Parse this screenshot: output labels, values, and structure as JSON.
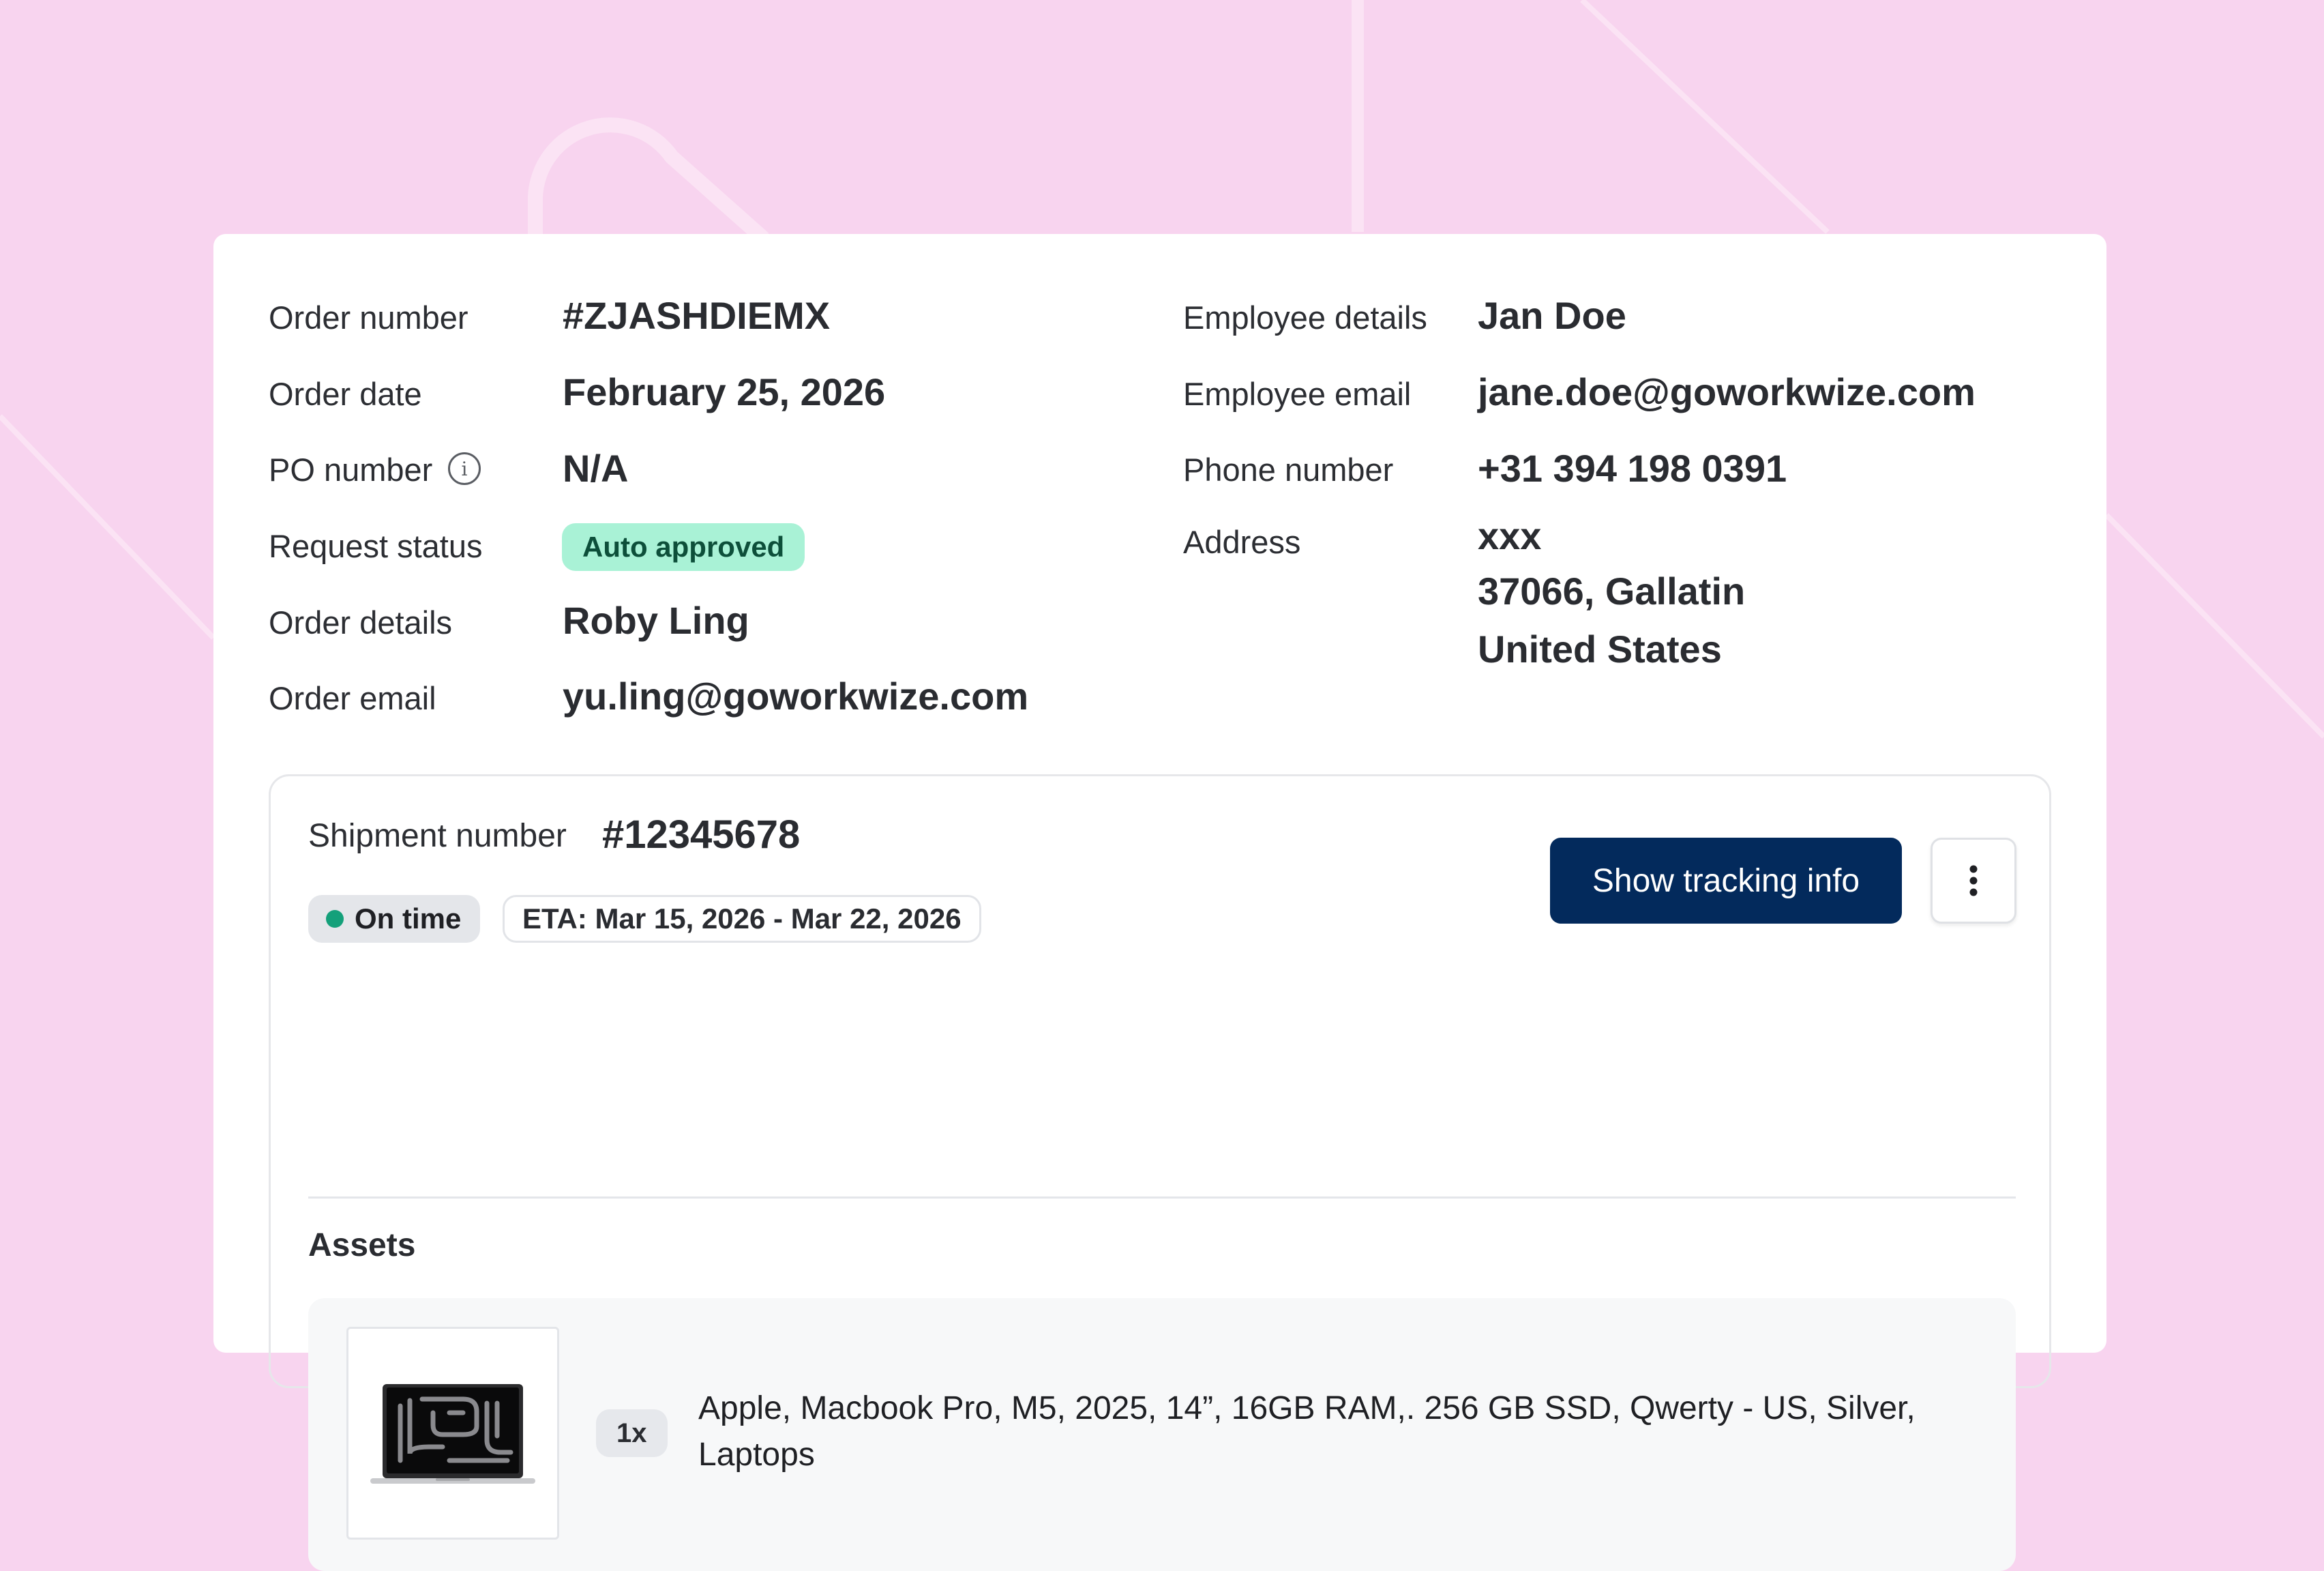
{
  "order": {
    "order_number_label": "Order number",
    "order_number": "#ZJASHDIEMX",
    "order_date_label": "Order date",
    "order_date": "February 25, 2026",
    "po_number_label": "PO number",
    "po_number": "N/A",
    "request_status_label": "Request status",
    "request_status": "Auto approved",
    "order_details_label": "Order details",
    "order_details": "Roby Ling",
    "order_email_label": "Order email",
    "order_email": "yu.ling@goworkwize.com"
  },
  "employee": {
    "details_label": "Employee details",
    "name": "Jan Doe",
    "email_label": "Employee email",
    "email": "jane.doe@goworkwize.com",
    "phone_label": "Phone number",
    "phone": "+31 394 198 0391",
    "address_label": "Address",
    "address_line1": "xxx",
    "address_line2": "37066, Gallatin",
    "address_line3": "United States"
  },
  "shipment": {
    "number_label": "Shipment number",
    "number": "#12345678",
    "status": "On time",
    "eta": "ETA: Mar 15, 2026 - Mar 22, 2026",
    "tracking_button": "Show tracking info",
    "more_icon": "more-vertical-icon"
  },
  "assets": {
    "title": "Assets",
    "items": [
      {
        "quantity": "1x",
        "description": "Apple, Macbook Pro, M5, 2025, 14”, 16GB RAM,. 256 GB SSD, Qwerty - US, Silver, Laptops"
      }
    ]
  },
  "colors": {
    "background": "#f8d4ef",
    "primary_button": "#032a5c",
    "status_approved": "#a9f2d6",
    "status_on_time_dot": "#14a07a"
  }
}
